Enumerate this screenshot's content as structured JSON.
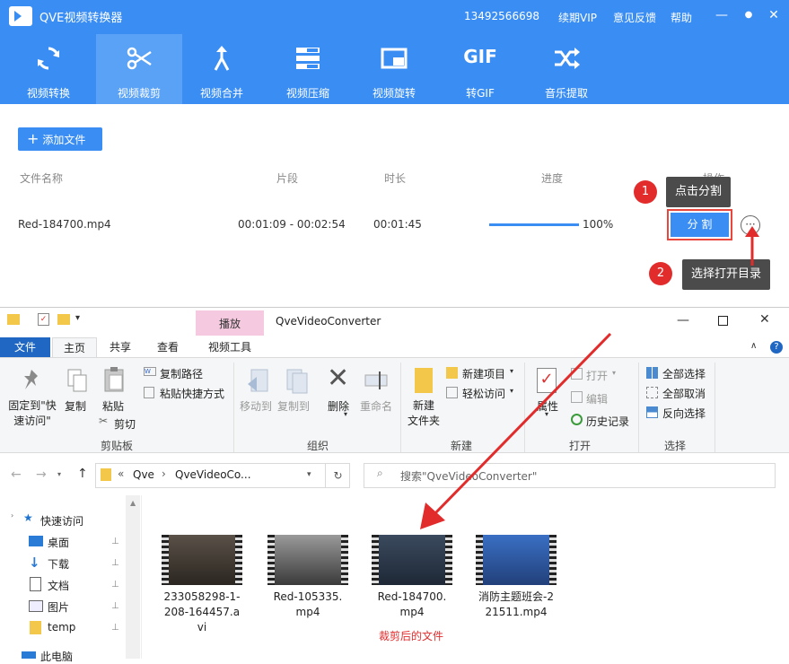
{
  "app": {
    "title": "QVE视频转换器",
    "phone": "13492566698",
    "vip": "续期VIP",
    "feedback": "意见反馈",
    "help": "帮助",
    "minimize": "—",
    "close": "✕"
  },
  "tools": [
    {
      "label": "视频转换",
      "icon": "convert-icon"
    },
    {
      "label": "视频裁剪",
      "icon": "scissors-icon"
    },
    {
      "label": "视频合并",
      "icon": "merge-icon"
    },
    {
      "label": "视频压缩",
      "icon": "compress-icon"
    },
    {
      "label": "视频旋转",
      "icon": "rotate-icon"
    },
    {
      "label": "转GIF",
      "icon": "gif-icon"
    },
    {
      "label": "音乐提取",
      "icon": "shuffle-icon"
    }
  ],
  "gif_text": "GIF",
  "file_panel": {
    "add_file": "添加文件",
    "headers": {
      "name": "文件名称",
      "segment": "片段",
      "duration": "时长",
      "progress": "进度",
      "action": "操作"
    },
    "row": {
      "name": "Red-184700.mp4",
      "segment": "00:01:09 - 00:02:54",
      "duration": "00:01:45",
      "progress_text": "100%",
      "progress": 1.0
    },
    "split": "分 割",
    "more": "···"
  },
  "annotations": {
    "step1": "1",
    "tip1": "点击分割",
    "step2": "2",
    "tip2": "选择打开目录",
    "result": "裁剪后的文件"
  },
  "explorer": {
    "title": "QveVideoConverter",
    "context_tab": "播放",
    "tabs": [
      "文件",
      "主页",
      "共享",
      "查看",
      "视频工具"
    ],
    "groups": {
      "clipboard": "剪贴板",
      "organize": "组织",
      "new": "新建",
      "open": "打开",
      "select": "选择"
    },
    "buttons": {
      "pin": "固定到\"快速访问\"",
      "copy": "复制",
      "paste": "粘贴",
      "copy_path": "复制路径",
      "paste_shortcut": "粘贴快捷方式",
      "cut": "剪切",
      "move_to": "移动到",
      "copy_to": "复制到",
      "delete": "删除",
      "rename": "重命名",
      "new_folder": "新建\n文件夹",
      "new_item": "新建项目",
      "easy_access": "轻松访问",
      "properties": "属性",
      "open": "打开",
      "edit": "编辑",
      "history": "历史记录",
      "select_all": "全部选择",
      "select_none": "全部取消",
      "invert": "反向选择"
    },
    "address": {
      "prefix": "«",
      "part1": "Qve",
      "part2": "QveVideoCo..."
    },
    "search_placeholder": "搜索\"QveVideoConverter\"",
    "nav": [
      {
        "label": "快速访问",
        "icon": "star-icon"
      },
      {
        "label": "桌面",
        "icon": "desktop-icon"
      },
      {
        "label": "下载",
        "icon": "download-icon"
      },
      {
        "label": "文档",
        "icon": "document-icon"
      },
      {
        "label": "图片",
        "icon": "pictures-icon"
      },
      {
        "label": "temp",
        "icon": "folder-icon"
      },
      {
        "label": "此电脑",
        "icon": "computer-icon"
      }
    ],
    "files": [
      {
        "name": "233058298-1-208-164457.avi"
      },
      {
        "name": "Red-105335.mp4"
      },
      {
        "name": "Red-184700.mp4"
      },
      {
        "name": "消防主题班会-221511.mp4"
      }
    ]
  },
  "colors": {
    "accent": "#3a8ef3",
    "annotation_red": "#e22c2c",
    "tooltip": "#4b4b4b"
  }
}
